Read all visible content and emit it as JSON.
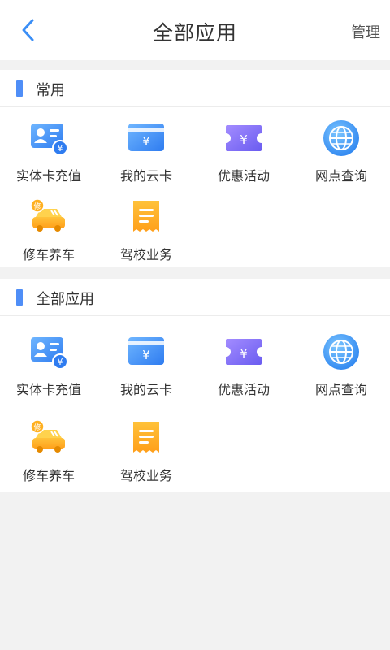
{
  "header": {
    "back_icon": "chevron-left-icon",
    "title": "全部应用",
    "manage_label": "管理"
  },
  "colors": {
    "accent": "#4f8ef7",
    "background": "#f2f2f2",
    "surface": "#ffffff"
  },
  "sections": [
    {
      "title": "常用",
      "apps": [
        {
          "label": "实体卡充值",
          "icon": "id-card-recharge-icon"
        },
        {
          "label": "我的云卡",
          "icon": "bank-card-icon"
        },
        {
          "label": "优惠活动",
          "icon": "coupon-icon"
        },
        {
          "label": "网点查询",
          "icon": "globe-icon"
        },
        {
          "label": "修车养车",
          "icon": "car-repair-icon"
        },
        {
          "label": "驾校业务",
          "icon": "receipt-icon"
        }
      ]
    },
    {
      "title": "全部应用",
      "apps": [
        {
          "label": "实体卡充值",
          "icon": "id-card-recharge-icon"
        },
        {
          "label": "我的云卡",
          "icon": "bank-card-icon"
        },
        {
          "label": "优惠活动",
          "icon": "coupon-icon"
        },
        {
          "label": "网点查询",
          "icon": "globe-icon"
        },
        {
          "label": "修车养车",
          "icon": "car-repair-icon"
        },
        {
          "label": "驾校业务",
          "icon": "receipt-icon"
        }
      ]
    }
  ]
}
